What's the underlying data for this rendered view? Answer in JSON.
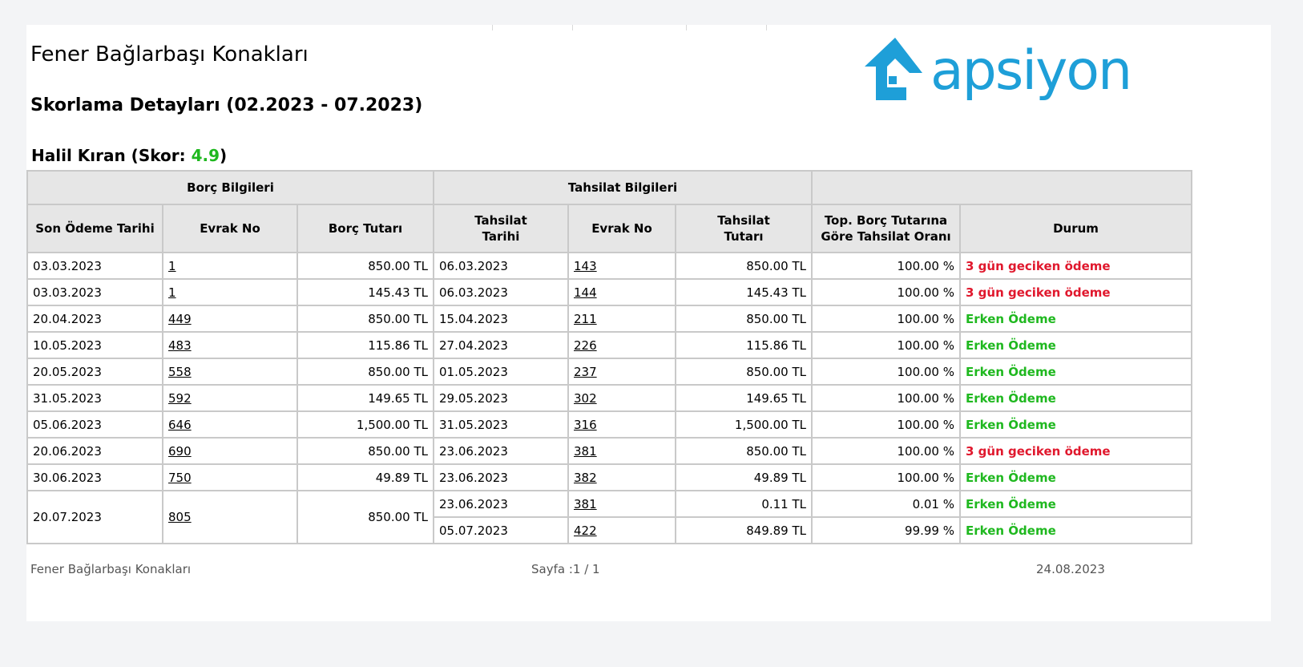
{
  "header": {
    "company": "Fener Bağlarbaşı Konakları",
    "title": "Skorlama Detayları (02.2023 - 07.2023)",
    "logo_text": "apsiyon",
    "brand_color": "#1e9fd8"
  },
  "person": {
    "prefix": "Halil Kıran (Skor: ",
    "score": "4.9",
    "suffix": ")"
  },
  "table": {
    "groups": {
      "borc": "Borç Bilgileri",
      "tahsilat": "Tahsilat Bilgileri"
    },
    "columns": {
      "son_odeme": "Son Ödeme Tarihi",
      "evrak_no": "Evrak No",
      "borc_tutari": "Borç Tutarı",
      "tahsilat_tarihi_1": "Tahsilat",
      "tahsilat_tarihi_2": "Tarihi",
      "evrak_no_2": "Evrak No",
      "tahsilat_tutari_1": "Tahsilat",
      "tahsilat_tutari_2": "Tutarı",
      "oran_1": "Top. Borç Tutarına",
      "oran_2": "Göre Tahsilat Oranı",
      "durum": "Durum"
    },
    "rows": [
      {
        "son_odeme": "03.03.2023",
        "evrak": "1",
        "borc": "850.00 TL",
        "payments": [
          {
            "tarih": "06.03.2023",
            "evrak": "143",
            "tutar": "850.00 TL",
            "oran": "100.00 %",
            "durum": "3 gün geciken ödeme",
            "status": "late"
          }
        ]
      },
      {
        "son_odeme": "03.03.2023",
        "evrak": "1",
        "borc": "145.43 TL",
        "payments": [
          {
            "tarih": "06.03.2023",
            "evrak": "144",
            "tutar": "145.43 TL",
            "oran": "100.00 %",
            "durum": "3 gün geciken ödeme",
            "status": "late"
          }
        ]
      },
      {
        "son_odeme": "20.04.2023",
        "evrak": "449",
        "borc": "850.00 TL",
        "payments": [
          {
            "tarih": "15.04.2023",
            "evrak": "211",
            "tutar": "850.00 TL",
            "oran": "100.00 %",
            "durum": "Erken Ödeme",
            "status": "early"
          }
        ]
      },
      {
        "son_odeme": "10.05.2023",
        "evrak": "483",
        "borc": "115.86 TL",
        "payments": [
          {
            "tarih": "27.04.2023",
            "evrak": "226",
            "tutar": "115.86 TL",
            "oran": "100.00 %",
            "durum": "Erken Ödeme",
            "status": "early"
          }
        ]
      },
      {
        "son_odeme": "20.05.2023",
        "evrak": "558",
        "borc": "850.00 TL",
        "payments": [
          {
            "tarih": "01.05.2023",
            "evrak": "237",
            "tutar": "850.00 TL",
            "oran": "100.00 %",
            "durum": "Erken Ödeme",
            "status": "early"
          }
        ]
      },
      {
        "son_odeme": "31.05.2023",
        "evrak": "592",
        "borc": "149.65 TL",
        "payments": [
          {
            "tarih": "29.05.2023",
            "evrak": "302",
            "tutar": "149.65 TL",
            "oran": "100.00 %",
            "durum": "Erken Ödeme",
            "status": "early"
          }
        ]
      },
      {
        "son_odeme": "05.06.2023",
        "evrak": "646",
        "borc": "1,500.00 TL",
        "payments": [
          {
            "tarih": "31.05.2023",
            "evrak": "316",
            "tutar": "1,500.00 TL",
            "oran": "100.00 %",
            "durum": "Erken Ödeme",
            "status": "early"
          }
        ]
      },
      {
        "son_odeme": "20.06.2023",
        "evrak": "690",
        "borc": "850.00 TL",
        "payments": [
          {
            "tarih": "23.06.2023",
            "evrak": "381",
            "tutar": "850.00 TL",
            "oran": "100.00 %",
            "durum": "3 gün geciken ödeme",
            "status": "late"
          }
        ]
      },
      {
        "son_odeme": "30.06.2023",
        "evrak": "750",
        "borc": "49.89 TL",
        "payments": [
          {
            "tarih": "23.06.2023",
            "evrak": "382",
            "tutar": "49.89 TL",
            "oran": "100.00 %",
            "durum": "Erken Ödeme",
            "status": "early"
          }
        ]
      },
      {
        "son_odeme": "20.07.2023",
        "evrak": "805",
        "borc": "850.00 TL",
        "payments": [
          {
            "tarih": "23.06.2023",
            "evrak": "381",
            "tutar": "0.11 TL",
            "oran": "0.01 %",
            "durum": "Erken Ödeme",
            "status": "early"
          },
          {
            "tarih": "05.07.2023",
            "evrak": "422",
            "tutar": "849.89 TL",
            "oran": "99.99 %",
            "durum": "Erken Ödeme",
            "status": "early"
          }
        ]
      }
    ]
  },
  "footer": {
    "left": "Fener Bağlarbaşı Konakları",
    "center": "Sayfa :1 / 1",
    "right": "24.08.2023"
  },
  "colors": {
    "late": "#e0182d",
    "early": "#1fb81f",
    "header_bg": "#e6e6e6"
  }
}
